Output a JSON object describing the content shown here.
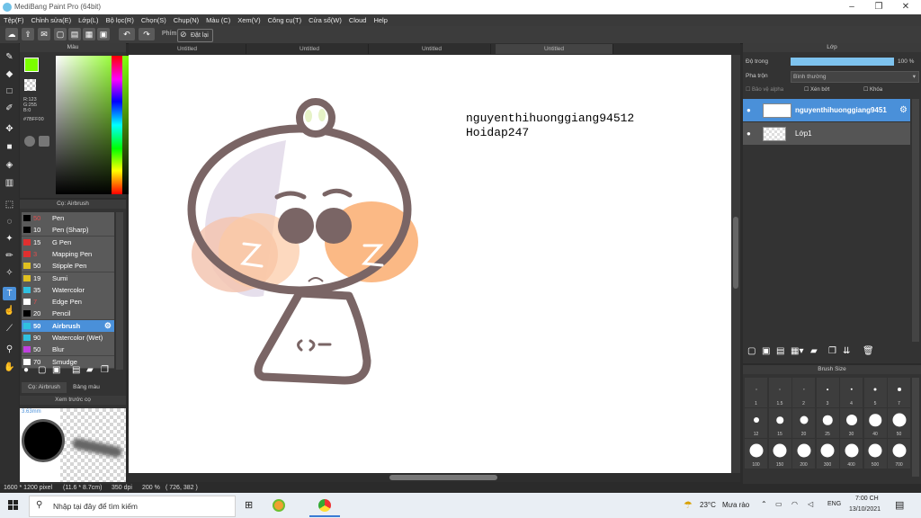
{
  "window": {
    "title": "MediBang Paint Pro (64bit)"
  },
  "menu": [
    "Tệp(F)",
    "Chỉnh sửa(E)",
    "Lớp(L)",
    "Bộ lọc(R)",
    "Chọn(S)",
    "Chụp(N)",
    "Màu (C)",
    "Xem(V)",
    "Công cụ(T)",
    "Cửa sổ(W)",
    "Cloud",
    "Help"
  ],
  "toolbar": {
    "key_label": "Phím",
    "reset_label": "Đặt lại"
  },
  "color_panel": {
    "title": "Màu",
    "readout": [
      "R:123",
      "G:255",
      "B:0"
    ],
    "hex": "#7BFF00",
    "fg": "#7bff00",
    "bg": "#000000"
  },
  "brush_panel": {
    "title": "Cọ: Airbrush",
    "items": [
      {
        "size": "50",
        "name": "Pen",
        "color": "#000000"
      },
      {
        "size": "10",
        "name": "Pen (Sharp)",
        "color": "#000000"
      },
      {
        "size": "15",
        "name": "G Pen",
        "color": "#e03030"
      },
      {
        "size": "3",
        "name": "Mapping Pen",
        "color": "#e03030"
      },
      {
        "size": "50",
        "name": "Stipple Pen",
        "color": "#e0c020"
      },
      {
        "size": "19",
        "name": "Sumi",
        "color": "#e0c020"
      },
      {
        "size": "35",
        "name": "Watercolor",
        "color": "#30c0e0"
      },
      {
        "size": "7",
        "name": "Edge Pen",
        "color": "#ffffff"
      },
      {
        "size": "20",
        "name": "Pencil",
        "color": "#000000"
      },
      {
        "size": "50",
        "name": "Airbrush",
        "color": "#30c0e0"
      },
      {
        "size": "90",
        "name": "Watercolor (Wet)",
        "color": "#30c0e0"
      },
      {
        "size": "50",
        "name": "Blur",
        "color": "#c040e0"
      },
      {
        "size": "70",
        "name": "Smudge",
        "color": "#ffffff"
      }
    ],
    "tab1": "Cọ: Airbrush",
    "tab2": "Bảng màu"
  },
  "preview_panel": {
    "title": "Xem trước cọ",
    "size": "3.63mm"
  },
  "tabs": [
    "Untitled",
    "Untitled",
    "Untitled",
    "Untitled"
  ],
  "canvas": {
    "text_line1": "nguyenthihuonggiang94512",
    "text_line2": "Hoidap247"
  },
  "layer_panel": {
    "title": "Lớp",
    "opacity_label": "Độ trong",
    "opacity_value": "100 %",
    "opacity_level": 1.0,
    "blend_label": "Pha trộn",
    "blend_value": "Bình thường",
    "protect_alpha": "Bảo vệ alpha",
    "clipping": "Xén bớt",
    "lock": "Khóa",
    "layers": [
      {
        "name": "nguyenthihuonggiang9451",
        "selected": true
      },
      {
        "name": "Lớp1",
        "selected": false
      }
    ]
  },
  "brush_size_panel": {
    "title": "Brush Size",
    "sizes": [
      "1",
      "1.5",
      "2",
      "3",
      "4",
      "5",
      "7",
      "12",
      "15",
      "20",
      "25",
      "30",
      "40",
      "50",
      "100",
      "150",
      "200",
      "300",
      "400",
      "500",
      "700"
    ]
  },
  "statusbar": {
    "dims": "1600 * 1200 pixel",
    "cm": "(11.6 * 8.7cm)",
    "dpi": "350 dpi",
    "zoom": "200 %",
    "coords": "( 726, 382 )"
  },
  "taskbar": {
    "search_placeholder": "Nhập tại đây để tìm kiếm",
    "weather_temp": "23°C",
    "weather_text": "Mưa rào",
    "lang": "ENG",
    "time": "7:00 CH",
    "date": "13/10/2021"
  }
}
